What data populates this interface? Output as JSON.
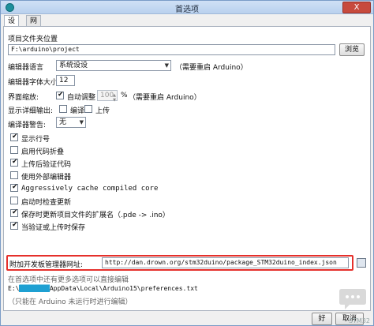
{
  "window": {
    "title": "首选项",
    "close_label": "X"
  },
  "tabs": [
    {
      "label": "设置"
    },
    {
      "label": "网络"
    }
  ],
  "sketchbook": {
    "label": "项目文件夹位置",
    "value": "F:\\arduino\\project",
    "browse_label": "浏览"
  },
  "language": {
    "label": "编辑器语言",
    "value": "系统设设",
    "note": "（需要重启 Arduino）"
  },
  "font_size": {
    "label": "编辑器字体大小",
    "value": "12"
  },
  "scale": {
    "label": "界面缩放:",
    "auto_label": "自动调整",
    "value": "100",
    "unit": "%",
    "note": "（需要重启 Arduino）"
  },
  "verbose": {
    "label": "显示详细输出:",
    "compile_label": "编译",
    "upload_label": "上传"
  },
  "warnings": {
    "label": "编译器警告:",
    "value": "无"
  },
  "options": [
    {
      "label": "显示行号",
      "checked": true
    },
    {
      "label": "启用代码折叠",
      "checked": false
    },
    {
      "label": "上传后验证代码",
      "checked": true
    },
    {
      "label": "使用外部编辑器",
      "checked": false
    },
    {
      "label": "Aggressively cache compiled core",
      "checked": true
    },
    {
      "label": "启动时检查更新",
      "checked": false
    },
    {
      "label": "保存时更新项目文件的扩展名（.pde -> .ino）",
      "checked": true
    },
    {
      "label": "当验证或上传时保存",
      "checked": true
    }
  ],
  "boards_url": {
    "label": "附加开发板管理器网址:",
    "value": "http://dan.drown.org/stm32duino/package_STM32duino_index.json"
  },
  "info": {
    "more_prefs": "在首选项中还有更多选项可以直接编辑",
    "prefs_path_prefix": "E:\\",
    "prefs_path_suffix": "AppData\\Local\\Arduino15\\preferences.txt",
    "edit_note": "（只能在 Arduino 未运行时进行编辑）"
  },
  "footer": {
    "ok_label": "好",
    "cancel_label": "取消",
    "watermark": "STM32"
  },
  "colors": {
    "highlight_box": "#e5302b",
    "redacted": "#1ea0d2",
    "title_bar": "#c4d9f2"
  }
}
